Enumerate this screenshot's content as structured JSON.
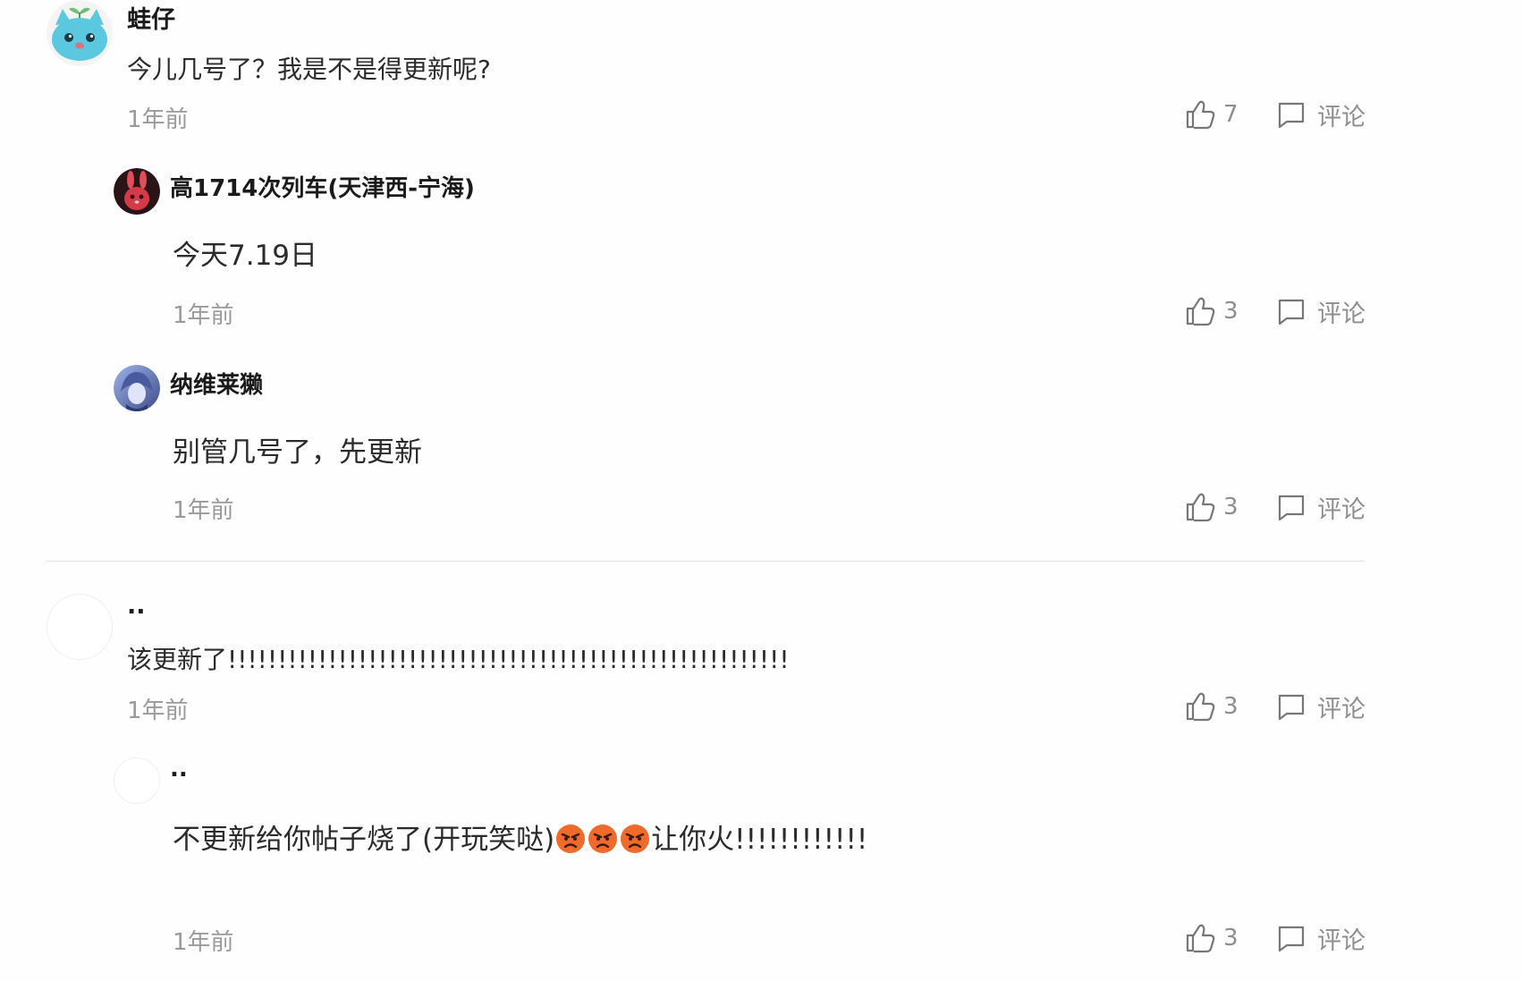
{
  "comments": [
    {
      "username": "蛙仔",
      "text": "今儿几号了？我是不是得更新呢?",
      "time": "1年前",
      "likes": "7",
      "reply_label": "评论"
    },
    {
      "username": "高1714次列车(天津西-宁海)",
      "text": "今天7.19日",
      "time": "1年前",
      "likes": "3",
      "reply_label": "评论"
    },
    {
      "username": "纳维莱獭",
      "text": "别管几号了，先更新",
      "time": "1年前",
      "likes": "3",
      "reply_label": "评论"
    },
    {
      "username": "..",
      "text": "该更新了!!!!!!!!!!!!!!!!!!!!!!!!!!!!!!!!!!!!!!!!!!!!!!!!!!!!!!!!",
      "time": "1年前",
      "likes": "3",
      "reply_label": "评论"
    },
    {
      "username": "..",
      "text_before_emoji": "不更新给你帖子烧了(开玩笑哒)",
      "emojis": [
        "angry-face",
        "angry-face",
        "angry-face"
      ],
      "text_after_emoji": "让你火!!!!!!!!!!!!",
      "time": "1年前",
      "likes": "3",
      "reply_label": "评论"
    }
  ],
  "colors": {
    "text": "#2b2b2b",
    "muted": "#9a9a9a",
    "divider": "#e3e3e3",
    "avatar_cat": "#5bc8e0"
  }
}
